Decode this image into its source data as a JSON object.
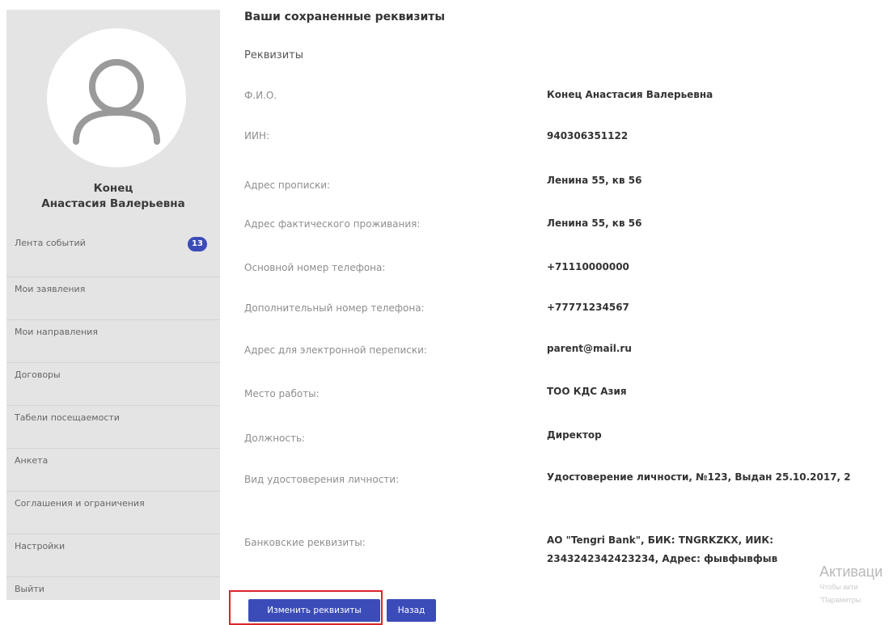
{
  "sidebar": {
    "user_first": "Конец",
    "user_last": "Анастасия Валерьевна",
    "menu": [
      {
        "label": "Лента событий",
        "badge": "13"
      },
      {
        "label": "Мои заявления"
      },
      {
        "label": "Мои направления"
      },
      {
        "label": "Договоры"
      },
      {
        "label": "Табели посещаемости"
      },
      {
        "label": "Анкета"
      },
      {
        "label": "Соглашения и ограничения"
      },
      {
        "label": "Настройки"
      },
      {
        "label": "Выйти"
      }
    ]
  },
  "main": {
    "title": "Ваши сохраненные реквизиты",
    "section": "Реквизиты",
    "rows": [
      {
        "label": "Ф.И.О.",
        "value": "Конец Анастасия Валерьевна"
      },
      {
        "label": "ИИН:",
        "value": "940306351122"
      },
      {
        "label": "Адрес прописки:",
        "value": "Ленина 55, кв 56"
      },
      {
        "label": "Адрес фактического проживания:",
        "value": "Ленина 55, кв 56"
      },
      {
        "label": "Основной номер телефона:",
        "value": "+71110000000"
      },
      {
        "label": "Дополнительный номер телефона:",
        "value": "+77771234567"
      },
      {
        "label": "Адрес для электронной переписки:",
        "value": "parent@mail.ru"
      },
      {
        "label": "Место работы:",
        "value": "ТОО КДС Азия"
      },
      {
        "label": "Должность:",
        "value": "Директор"
      },
      {
        "label": "Вид удостоверения личности:",
        "value": "Удостоверение личности, №123, Выдан 25.10.2017, 2"
      },
      {
        "label": "Банковские реквизиты:",
        "value": "АО \"Tengri Bank\", БИК: TNGRKZKX, ИИК: 2343242342423234, Адрес: фывфывфыв"
      }
    ],
    "buttons": {
      "edit": "Изменить реквизиты",
      "back": "Назад"
    }
  },
  "watermark": {
    "title": "Активаци",
    "line1": "Чтобы акти",
    "line2": "\"Параметры"
  },
  "colors": {
    "accent": "#3b4cb8",
    "sidebar_bg": "#e4e4e4",
    "highlight": "#d9262c"
  }
}
